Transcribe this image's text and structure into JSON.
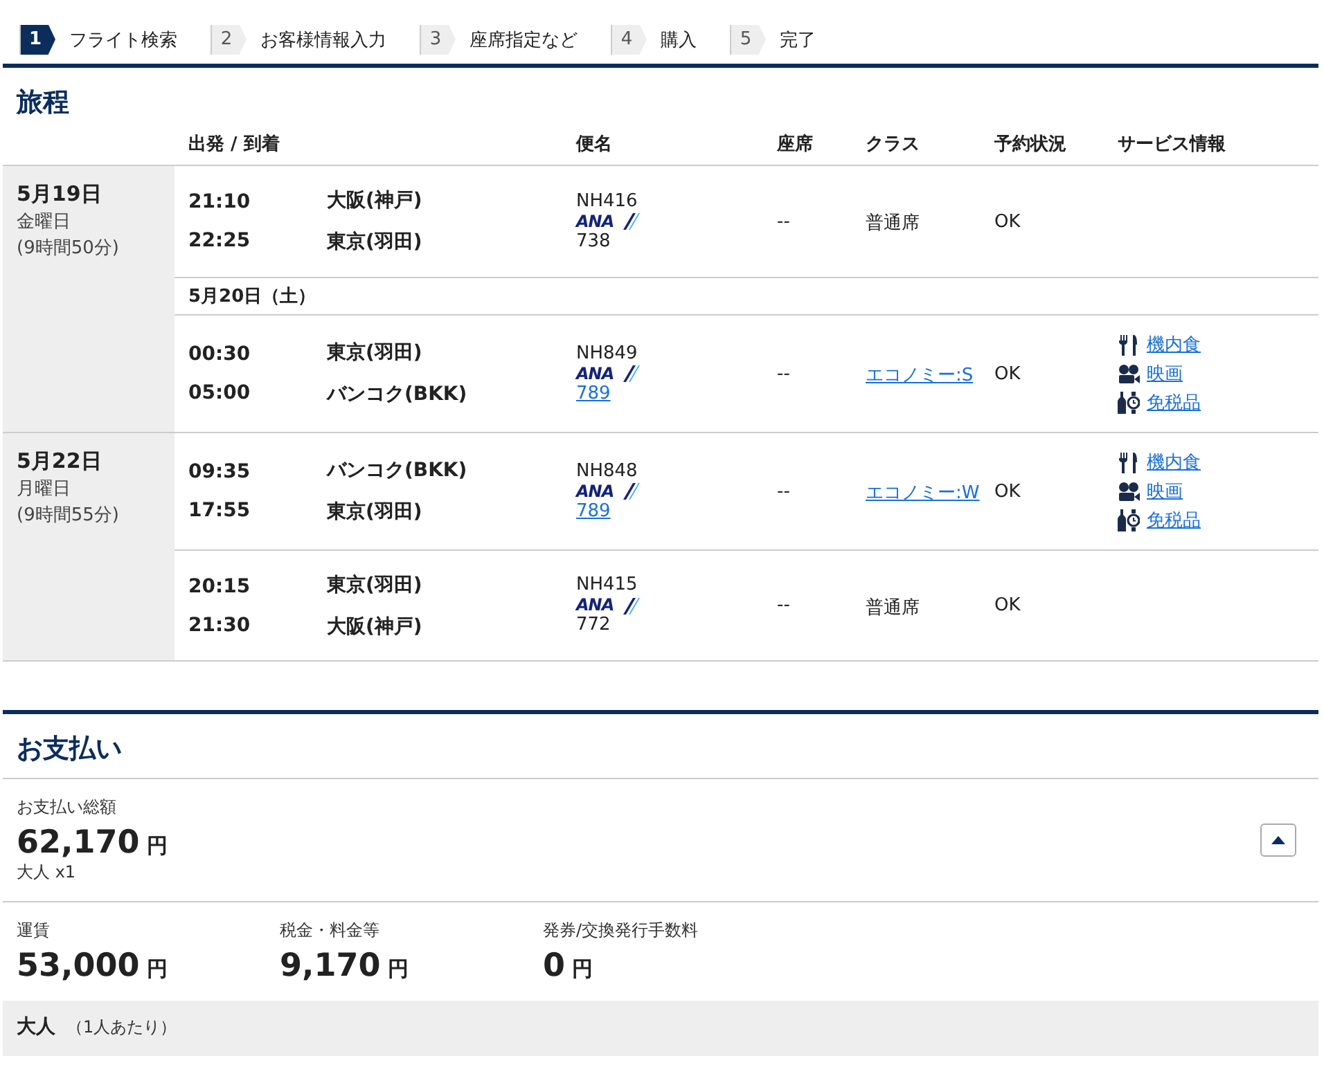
{
  "steps": [
    {
      "number": "1",
      "label": "フライト検索",
      "selected": true
    },
    {
      "number": "2",
      "label": "お客様情報入力",
      "selected": false
    },
    {
      "number": "3",
      "label": "座席指定など",
      "selected": false
    },
    {
      "number": "4",
      "label": "購入",
      "selected": false
    },
    {
      "number": "5",
      "label": "完了",
      "selected": false
    }
  ],
  "itinerary": {
    "title": "旅程",
    "columns": [
      "出発 / 到着",
      "便名",
      "座席",
      "クラス",
      "予約状況",
      "サービス情報"
    ],
    "days": [
      {
        "date": "5月19日",
        "weekday": "金曜日",
        "duration": "(9時間50分)",
        "items": [
          {
            "kind": "segment",
            "departure": {
              "time": "21:10",
              "city": "大阪(神戸)"
            },
            "arrival": {
              "time": "22:25",
              "city": "東京(羽田)"
            },
            "flight": "NH416",
            "airline": "ANA",
            "aircraft": "738",
            "aircraft_link": false,
            "seat": "--",
            "class": "普通席",
            "class_link": false,
            "status": "OK"
          },
          {
            "kind": "date",
            "label": "5月20日（土）"
          },
          {
            "kind": "segment",
            "departure": {
              "time": "00:30",
              "city": "東京(羽田)"
            },
            "arrival": {
              "time": "05:00",
              "city": "バンコク(BKK)"
            },
            "flight": "NH849",
            "airline": "ANA",
            "aircraft": "789",
            "aircraft_link": true,
            "seat": "--",
            "class": "エコノミー:S",
            "class_link": true,
            "status": "OK",
            "services": [
              {
                "kind": "meal",
                "label": "機内食"
              },
              {
                "kind": "movie",
                "label": "映画"
              },
              {
                "kind": "dutyfree",
                "label": "免税品"
              }
            ]
          }
        ]
      },
      {
        "date": "5月22日",
        "weekday": "月曜日",
        "duration": "(9時間55分)",
        "items": [
          {
            "kind": "segment",
            "departure": {
              "time": "09:35",
              "city": "バンコク(BKK)"
            },
            "arrival": {
              "time": "17:55",
              "city": "東京(羽田)"
            },
            "flight": "NH848",
            "airline": "ANA",
            "aircraft": "789",
            "aircraft_link": true,
            "seat": "--",
            "class": "エコノミー:W",
            "class_link": true,
            "status": "OK",
            "services": [
              {
                "kind": "meal",
                "label": "機内食"
              },
              {
                "kind": "movie",
                "label": "映画"
              },
              {
                "kind": "dutyfree",
                "label": "免税品"
              }
            ]
          },
          {
            "kind": "segment",
            "departure": {
              "time": "20:15",
              "city": "東京(羽田)"
            },
            "arrival": {
              "time": "21:30",
              "city": "大阪(神戸)"
            },
            "flight": "NH415",
            "airline": "ANA",
            "aircraft": "772",
            "aircraft_link": false,
            "seat": "--",
            "class": "普通席",
            "class_link": false,
            "status": "OK"
          }
        ]
      }
    ]
  },
  "payment": {
    "title": "お支払い",
    "total_label": "お支払い総額",
    "total_amount": "62,170",
    "currency": "円",
    "passengers": "大人 x1",
    "expanded": true,
    "breakdown": [
      {
        "label": "運賃",
        "amount": "53,000",
        "currency": "円"
      },
      {
        "label": "税金・料金等",
        "amount": "9,170",
        "currency": "円"
      },
      {
        "label": "発券/交換発行手数料",
        "amount": "0",
        "currency": "円"
      }
    ],
    "passenger_type": "大人",
    "per_person": "（1人あたり）"
  }
}
